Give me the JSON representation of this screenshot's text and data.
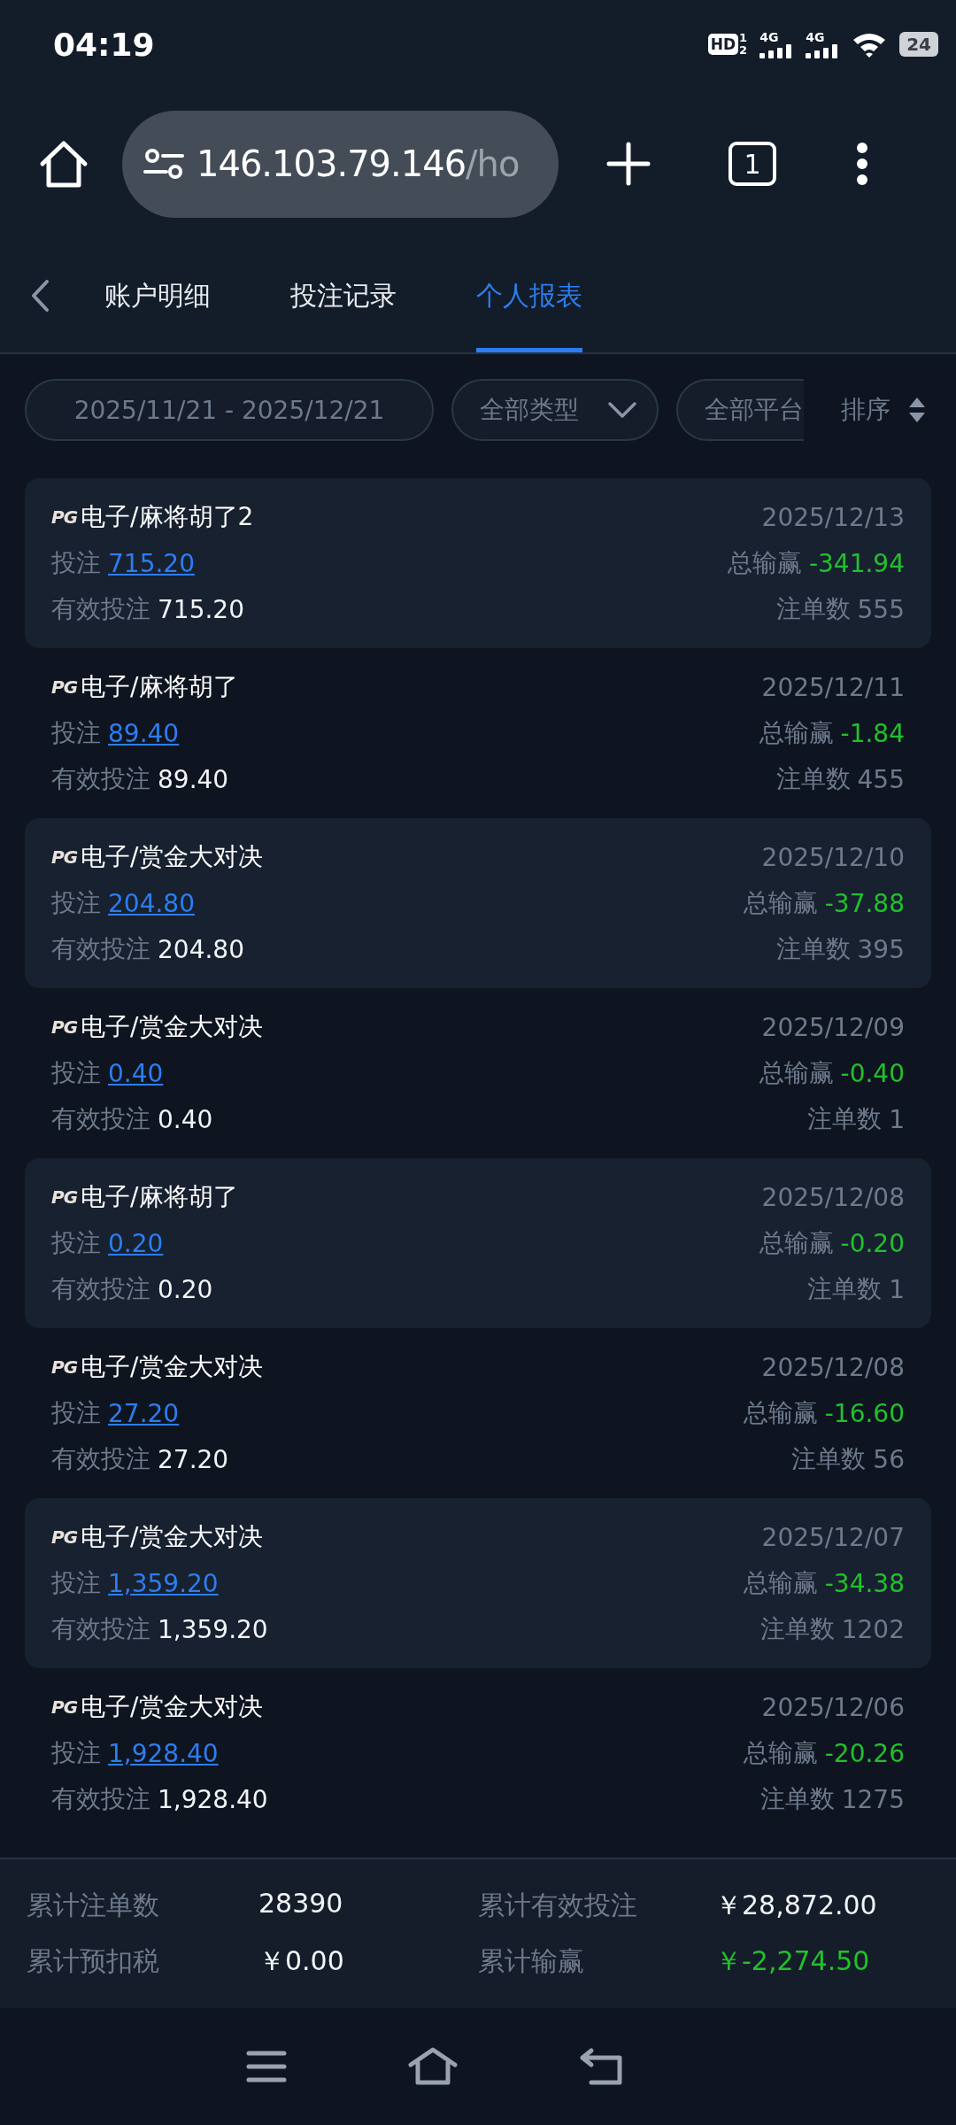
{
  "status_bar": {
    "time": "04:19",
    "hd": "HD",
    "hd_marks": [
      "1",
      "2"
    ],
    "sims": [
      {
        "label": "4G"
      },
      {
        "label": "4G"
      }
    ],
    "battery": "24"
  },
  "browser": {
    "url_host": "146.103.79.146",
    "url_path": "/ho",
    "tab_count": "1"
  },
  "tabs": [
    {
      "label": "账户明细",
      "selected": false
    },
    {
      "label": "投注记录",
      "selected": false
    },
    {
      "label": "个人报表",
      "selected": true
    }
  ],
  "filters": {
    "date_range": "2025/11/21 - 2025/12/21",
    "type": "全部类型",
    "platform": "全部平台",
    "sort": "排序"
  },
  "records": [
    {
      "shaded": true,
      "logo": "PG",
      "title": "电子/麻将胡了2",
      "date": "2025/12/13",
      "bet_label": "投注",
      "bet": "715.20",
      "win_label": "总输赢",
      "win": "-341.94",
      "negative": true,
      "valid_label": "有效投注",
      "valid": "715.20",
      "count_label": "注单数",
      "count": "555"
    },
    {
      "shaded": false,
      "logo": "PG",
      "title": "电子/麻将胡了",
      "date": "2025/12/11",
      "bet_label": "投注",
      "bet": "89.40",
      "win_label": "总输赢",
      "win": "-1.84",
      "negative": true,
      "valid_label": "有效投注",
      "valid": "89.40",
      "count_label": "注单数",
      "count": "455"
    },
    {
      "shaded": true,
      "logo": "PG",
      "title": "电子/赏金大对决",
      "date": "2025/12/10",
      "bet_label": "投注",
      "bet": "204.80",
      "win_label": "总输赢",
      "win": "-37.88",
      "negative": true,
      "valid_label": "有效投注",
      "valid": "204.80",
      "count_label": "注单数",
      "count": "395"
    },
    {
      "shaded": false,
      "logo": "PG",
      "title": "电子/赏金大对决",
      "date": "2025/12/09",
      "bet_label": "投注",
      "bet": "0.40",
      "win_label": "总输赢",
      "win": "-0.40",
      "negative": true,
      "valid_label": "有效投注",
      "valid": "0.40",
      "count_label": "注单数",
      "count": "1"
    },
    {
      "shaded": true,
      "logo": "PG",
      "title": "电子/麻将胡了",
      "date": "2025/12/08",
      "bet_label": "投注",
      "bet": "0.20",
      "win_label": "总输赢",
      "win": "-0.20",
      "negative": true,
      "valid_label": "有效投注",
      "valid": "0.20",
      "count_label": "注单数",
      "count": "1"
    },
    {
      "shaded": false,
      "logo": "PG",
      "title": "电子/赏金大对决",
      "date": "2025/12/08",
      "bet_label": "投注",
      "bet": "27.20",
      "win_label": "总输赢",
      "win": "-16.60",
      "negative": true,
      "valid_label": "有效投注",
      "valid": "27.20",
      "count_label": "注单数",
      "count": "56"
    },
    {
      "shaded": true,
      "logo": "PG",
      "title": "电子/赏金大对决",
      "date": "2025/12/07",
      "bet_label": "投注",
      "bet": "1,359.20",
      "win_label": "总输赢",
      "win": "-34.38",
      "negative": true,
      "valid_label": "有效投注",
      "valid": "1,359.20",
      "count_label": "注单数",
      "count": "1202"
    },
    {
      "shaded": false,
      "logo": "PG",
      "title": "电子/赏金大对决",
      "date": "2025/12/06",
      "bet_label": "投注",
      "bet": "1,928.40",
      "win_label": "总输赢",
      "win": "-20.26",
      "negative": true,
      "valid_label": "有效投注",
      "valid": "1,928.40",
      "count_label": "注单数",
      "count": "1275"
    }
  ],
  "summary": [
    {
      "label": "累计注单数",
      "value": "28390",
      "negative": false
    },
    {
      "label": "累计有效投注",
      "value": "￥28,872.00",
      "negative": false
    },
    {
      "label": "累计预扣税",
      "value": "￥0.00",
      "negative": false
    },
    {
      "label": "累计输赢",
      "value": "￥-2,274.50",
      "negative": true
    }
  ]
}
